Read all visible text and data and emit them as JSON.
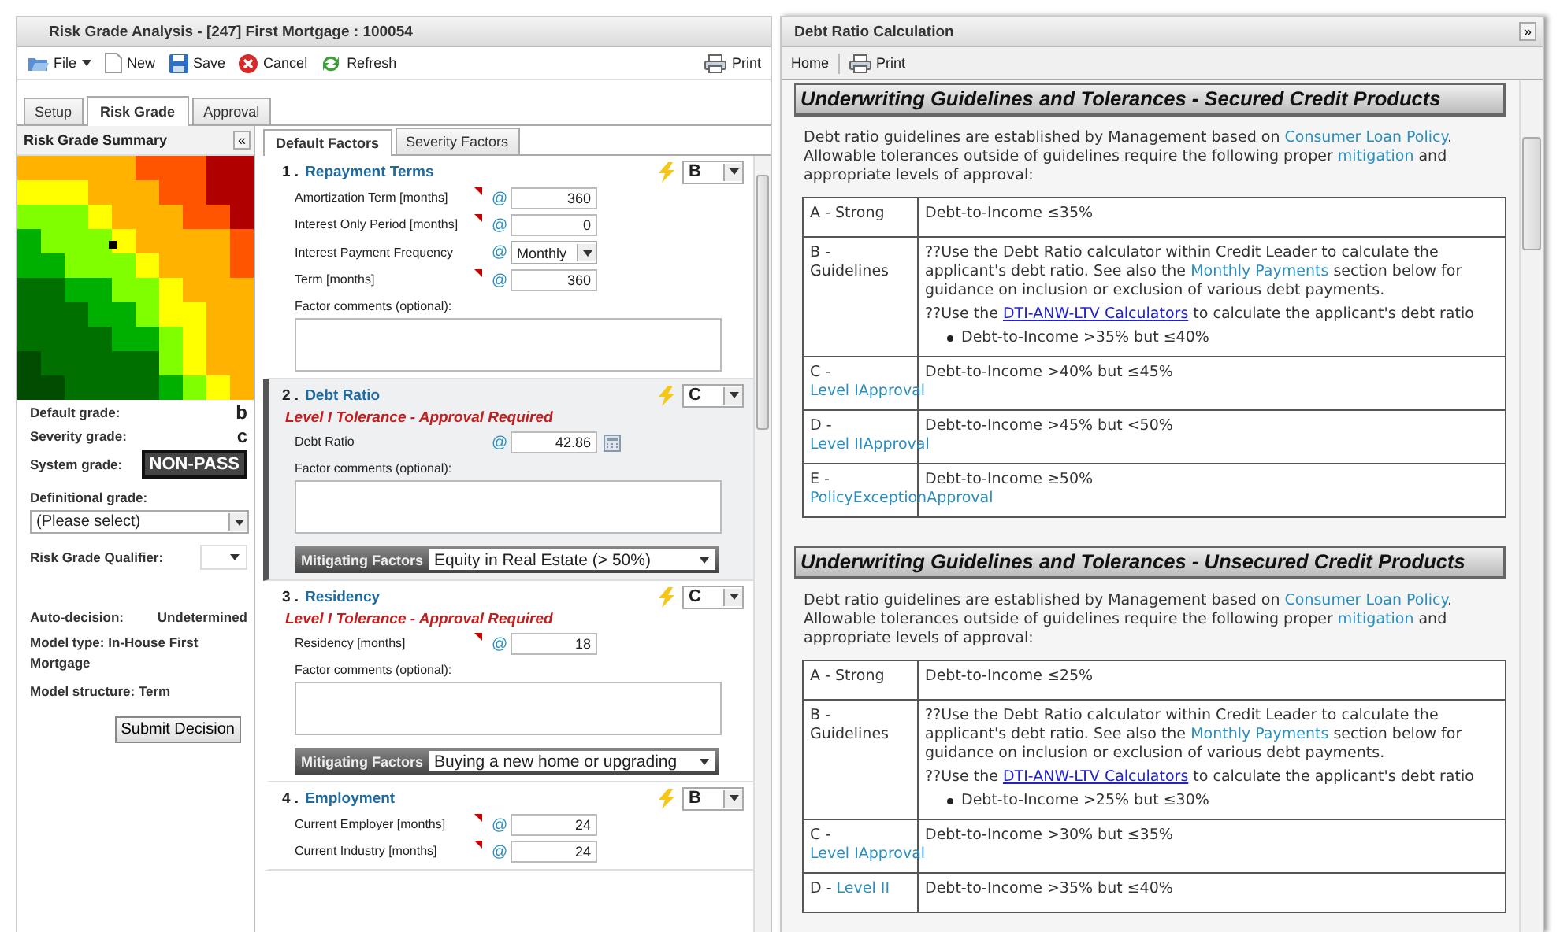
{
  "left_window": {
    "title": "Risk Grade Analysis - [247] First Mortgage : 100054",
    "toolbar": [
      {
        "label": "File",
        "kind": "file"
      },
      {
        "label": "New",
        "kind": "new"
      },
      {
        "label": "Save",
        "kind": "save"
      },
      {
        "label": "Cancel",
        "kind": "cancel"
      },
      {
        "label": "Refresh",
        "kind": "refresh"
      }
    ],
    "print": "Print",
    "tabs": [
      {
        "label": "Setup",
        "selected": false
      },
      {
        "label": "Risk Grade",
        "selected": true
      },
      {
        "label": "Approval",
        "selected": false
      }
    ],
    "summary": {
      "title": "Risk Grade Summary",
      "collapse": "«",
      "grades": [
        {
          "label": "Default grade:",
          "value": "b"
        },
        {
          "label": "Severity grade:",
          "value": "c"
        }
      ],
      "system_grade": {
        "label": "System grade:",
        "value": "NON-PASS"
      },
      "definitional_grade": {
        "label": "Definitional grade:",
        "value": "(Please select)"
      },
      "qualifier": {
        "label": "Risk Grade Qualifier:"
      },
      "info": [
        {
          "label": "Auto-decision:",
          "value": "Undetermined",
          "kind": "split"
        },
        {
          "label": "Model type:",
          "value": "In-House First Mortgage",
          "kind": "inline"
        },
        {
          "label": "Model structure:",
          "value": "Term",
          "kind": "inline"
        }
      ],
      "submit": "Submit Decision"
    },
    "factor_tabs": [
      {
        "label": "Default Factors",
        "selected": true
      },
      {
        "label": "Severity Factors",
        "selected": false
      }
    ],
    "factors": [
      {
        "number": "1 .",
        "title": "Repayment Terms",
        "grade": "B",
        "highlighted": false,
        "fields": [
          {
            "label": "Amortization Term [months]",
            "kind": "text",
            "value": "360",
            "flag": true,
            "link_icon": "@"
          },
          {
            "label": "Interest Only Period [months]",
            "kind": "text",
            "value": "0",
            "flag": true,
            "link_icon": "@"
          },
          {
            "label": "Interest Payment Frequency",
            "kind": "select",
            "value": "Monthly",
            "flag": false,
            "link_icon": "@"
          },
          {
            "label": "Term [months]",
            "kind": "text",
            "value": "360",
            "flag": true,
            "link_icon": "@"
          }
        ],
        "comments_label": "Factor comments (optional):"
      },
      {
        "number": "2 .",
        "title": "Debt Ratio",
        "grade": "C",
        "highlighted": true,
        "tolerance": "Level I Tolerance - Approval Required",
        "fields": [
          {
            "label": "Debt Ratio",
            "kind": "calc",
            "value": "42.86",
            "flag": false,
            "link_icon": "@"
          }
        ],
        "comments_label": "Factor comments (optional):",
        "mitigating": {
          "label": "Mitigating Factors",
          "value": "Equity in Real Estate (> 50%)"
        }
      },
      {
        "number": "3 .",
        "title": "Residency",
        "grade": "C",
        "highlighted": false,
        "tolerance": "Level I Tolerance - Approval Required",
        "fields": [
          {
            "label": "Residency [months]",
            "kind": "text",
            "value": "18",
            "flag": true,
            "link_icon": "@"
          }
        ],
        "comments_label": "Factor comments (optional):",
        "mitigating": {
          "label": "Mitigating Factors",
          "value": "Buying a new home or upgrading"
        }
      },
      {
        "number": "4 .",
        "title": "Employment",
        "grade": "B",
        "highlighted": false,
        "fields": [
          {
            "label": "Current Employer [months]",
            "kind": "text",
            "value": "24",
            "flag": true,
            "link_icon": "@"
          },
          {
            "label": "Current Industry [months]",
            "kind": "text",
            "value": "24",
            "flag": true,
            "link_icon": "@"
          }
        ]
      }
    ]
  },
  "right_window": {
    "title": "Debt Ratio Calculation",
    "expand": "»",
    "toolbar": {
      "home": "Home",
      "print": "Print"
    },
    "sections": [
      {
        "heading": "Underwriting Guidelines and Tolerances - Secured Credit Products",
        "intro": [
          {
            "text": "Debt ratio guidelines are established by Management based on ",
            "kind": "plain"
          },
          {
            "text": "Consumer Loan Policy",
            "kind": "link"
          },
          {
            "text": ". Allowable tolerances outside of guidelines require the following proper ",
            "kind": "plain"
          },
          {
            "text": "mitigation",
            "kind": "link"
          },
          {
            "text": " and appropriate levels of approval:",
            "kind": "plain"
          }
        ],
        "rows": [
          {
            "grade": [
              {
                "text": "A - Strong",
                "kind": "plain"
              }
            ],
            "content": [
              {
                "kind": "para",
                "parts": [
                  {
                    "text": "Debt-to-Income ≤35%",
                    "kind": "plain"
                  }
                ]
              }
            ]
          },
          {
            "grade": [
              {
                "text": "B - Guidelines",
                "kind": "plain"
              }
            ],
            "content": [
              {
                "kind": "para",
                "parts": [
                  {
                    "text": "??Use the Debt Ratio calculator within Credit Leader to calculate the applicant's debt ratio. See also the ",
                    "kind": "plain"
                  },
                  {
                    "text": "Monthly Payments",
                    "kind": "link"
                  },
                  {
                    "text": " section below for guidance on inclusion or exclusion of various debt payments.",
                    "kind": "plain"
                  }
                ]
              },
              {
                "kind": "para",
                "parts": [
                  {
                    "text": "??Use the ",
                    "kind": "plain"
                  },
                  {
                    "text": "DTI-ANW-LTV Calculators",
                    "kind": "url"
                  },
                  {
                    "text": " to calculate the applicant's debt ratio",
                    "kind": "plain"
                  }
                ]
              },
              {
                "kind": "bullet",
                "parts": [
                  {
                    "text": "Debt-to-Income >35% but ≤40%",
                    "kind": "plain"
                  }
                ]
              }
            ]
          },
          {
            "grade": [
              {
                "text": "C - ",
                "kind": "plain"
              },
              {
                "text": "Level I",
                "kind": "link"
              },
              {
                "text": "Approval",
                "kind": "link"
              }
            ],
            "content": [
              {
                "kind": "para",
                "parts": [
                  {
                    "text": "Debt-to-Income >40% but ≤45%",
                    "kind": "plain"
                  }
                ]
              }
            ]
          },
          {
            "grade": [
              {
                "text": "D - ",
                "kind": "plain"
              },
              {
                "text": "Level II",
                "kind": "link"
              },
              {
                "text": "Approval",
                "kind": "link"
              }
            ],
            "content": [
              {
                "kind": "para",
                "parts": [
                  {
                    "text": "Debt-to-Income >45% but <50%",
                    "kind": "plain"
                  }
                ]
              }
            ]
          },
          {
            "grade": [
              {
                "text": "E - ",
                "kind": "plain"
              },
              {
                "text": "Policy",
                "kind": "link"
              },
              {
                "text": "Exception",
                "kind": "link"
              },
              {
                "text": "Approval",
                "kind": "link"
              }
            ],
            "content": [
              {
                "kind": "para",
                "parts": [
                  {
                    "text": "Debt-to-Income ≥50%",
                    "kind": "plain"
                  }
                ]
              }
            ]
          }
        ]
      },
      {
        "heading": "Underwriting Guidelines and Tolerances - Unsecured Credit Products",
        "intro": [
          {
            "text": "Debt ratio guidelines are established by Management based on ",
            "kind": "plain"
          },
          {
            "text": "Consumer Loan Policy",
            "kind": "link"
          },
          {
            "text": ". Allowable tolerances outside of guidelines require the following proper ",
            "kind": "plain"
          },
          {
            "text": "mitigation",
            "kind": "link"
          },
          {
            "text": " and appropriate levels of approval:",
            "kind": "plain"
          }
        ],
        "rows": [
          {
            "grade": [
              {
                "text": "A - Strong",
                "kind": "plain"
              }
            ],
            "content": [
              {
                "kind": "para",
                "parts": [
                  {
                    "text": "Debt-to-Income ≤25%",
                    "kind": "plain"
                  }
                ]
              }
            ]
          },
          {
            "grade": [
              {
                "text": "B - Guidelines",
                "kind": "plain"
              }
            ],
            "content": [
              {
                "kind": "para",
                "parts": [
                  {
                    "text": "??Use the Debt Ratio calculator within Credit Leader to calculate the applicant's debt ratio. See also the ",
                    "kind": "plain"
                  },
                  {
                    "text": "Monthly Payments",
                    "kind": "link"
                  },
                  {
                    "text": " section below for guidance on inclusion or exclusion of various debt payments.",
                    "kind": "plain"
                  }
                ]
              },
              {
                "kind": "para",
                "parts": [
                  {
                    "text": "??Use the ",
                    "kind": "plain"
                  },
                  {
                    "text": "DTI-ANW-LTV Calculators",
                    "kind": "url"
                  },
                  {
                    "text": " to calculate the applicant's debt ratio",
                    "kind": "plain"
                  }
                ]
              },
              {
                "kind": "bullet",
                "parts": [
                  {
                    "text": "Debt-to-Income >25% but ≤30%",
                    "kind": "plain"
                  }
                ]
              }
            ]
          },
          {
            "grade": [
              {
                "text": "C - ",
                "kind": "plain"
              },
              {
                "text": "Level I",
                "kind": "link"
              },
              {
                "text": "Approval",
                "kind": "link"
              }
            ],
            "content": [
              {
                "kind": "para",
                "parts": [
                  {
                    "text": "Debt-to-Income >30% but ≤35%",
                    "kind": "plain"
                  }
                ]
              }
            ]
          },
          {
            "grade": [
              {
                "text": "D - ",
                "kind": "plain"
              },
              {
                "text": "Level II",
                "kind": "link"
              }
            ],
            "content": [
              {
                "kind": "para",
                "parts": [
                  {
                    "text": "Debt-to-Income >35% but ≤40%",
                    "kind": "plain"
                  }
                ]
              }
            ]
          }
        ]
      }
    ]
  }
}
